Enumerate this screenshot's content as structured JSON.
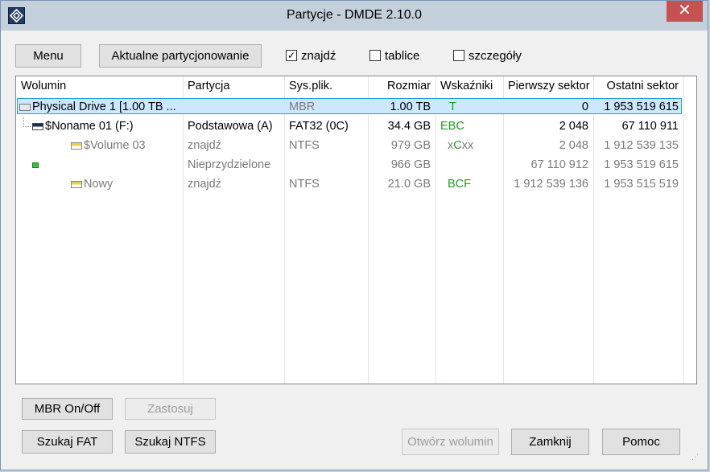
{
  "window": {
    "title": "Partycje - DMDE 2.10.0",
    "close_label": "✕"
  },
  "toolbar": {
    "menu_label": "Menu",
    "current_partitioning_label": "Aktualne partycjonowanie",
    "find_label": "znajdź",
    "find_checked": true,
    "tables_label": "tablice",
    "tables_checked": false,
    "details_label": "szczegóły",
    "details_checked": false
  },
  "table": {
    "columns": [
      "Wolumin",
      "Partycja",
      "Sys.plik.",
      "Rozmiar",
      "Wskaźniki",
      "Pierwszy sektor",
      "Ostatni sektor"
    ],
    "rows": [
      {
        "volume": "Physical Drive 1 [1.00 TB ...",
        "partition": "",
        "fs": "MBR",
        "size": "1.00 TB",
        "flags": "T",
        "first": "0",
        "last": "1 953 519 615",
        "selected": true
      },
      {
        "volume": "$Noname 01 (F:)",
        "partition": "Podstawowa (A)",
        "fs": "FAT32 (0C)",
        "size": "34.4 GB",
        "flags": "EBC",
        "first": "2 048",
        "last": "67 110 911"
      },
      {
        "volume": "$Volume 03",
        "partition": "znajdź",
        "fs": "NTFS",
        "size": "979 GB",
        "flags_prefix": "x",
        "flags": "C",
        "flags_suffix": "xx",
        "first": "2 048",
        "last": "1 912 539 135"
      },
      {
        "volume": "",
        "partition": "Nieprzydzielone",
        "fs": "",
        "size": "966 GB",
        "flags": "",
        "first": "67 110 912",
        "last": "1 953 519 615"
      },
      {
        "volume": "Nowy",
        "partition": "znajdź",
        "fs": "NTFS",
        "size": "21.0 GB",
        "flags": "BCF",
        "first": "1 912 539 136",
        "last": "1 953 515 519"
      }
    ]
  },
  "buttons": {
    "mbr_toggle": "MBR On/Off",
    "apply": "Zastosuj",
    "search_fat": "Szukaj FAT",
    "search_ntfs": "Szukaj NTFS",
    "open_volume": "Otwórz wolumin",
    "close": "Zamknij",
    "help": "Pomoc"
  }
}
